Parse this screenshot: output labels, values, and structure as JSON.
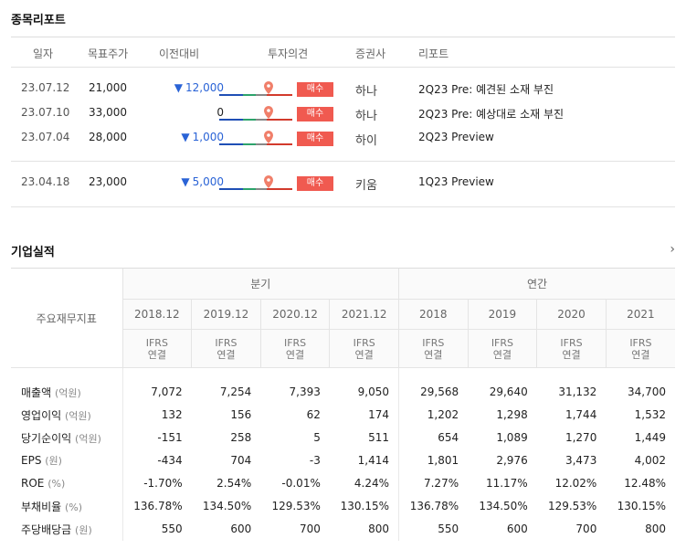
{
  "report_section": {
    "title": "종목리포트",
    "headers": {
      "date": "일자",
      "target": "목표주가",
      "diff": "이전대비",
      "opinion": "투자의견",
      "broker": "증권사",
      "report": "리포트"
    },
    "rows": [
      {
        "date": "23.07.12",
        "target": "21,000",
        "diff": "12,000",
        "dir": "down",
        "opinion": "매수",
        "broker": "하나",
        "report": "2Q23 Pre: 예견된 소재 부진"
      },
      {
        "date": "23.07.10",
        "target": "33,000",
        "diff": "0",
        "dir": "none",
        "opinion": "매수",
        "broker": "하나",
        "report": "2Q23 Pre: 예상대로 소재 부진"
      },
      {
        "date": "23.07.04",
        "target": "28,000",
        "diff": "1,000",
        "dir": "down",
        "opinion": "매수",
        "broker": "하이",
        "report": "2Q23 Preview"
      },
      {
        "date": "23.04.18",
        "target": "23,000",
        "diff": "5,000",
        "dir": "down",
        "opinion": "매수",
        "broker": "키움",
        "report": "1Q23 Preview"
      }
    ],
    "down_arrow": "▼",
    "colors": {
      "down": "#2a63d6",
      "buy_badge": "#f05a50"
    }
  },
  "financials": {
    "title": "기업실적",
    "more_chevron": "›",
    "main_header": "주요재무지표",
    "group_quarter": "분기",
    "group_annual": "연간",
    "periods": [
      "2018.12",
      "2019.12",
      "2020.12",
      "2021.12",
      "2018",
      "2019",
      "2020",
      "2021"
    ],
    "ifrs_line1": "IFRS",
    "ifrs_line2": "연결",
    "rows": [
      {
        "label": "매출액",
        "unit": "(억원)",
        "values": [
          "7,072",
          "7,254",
          "7,393",
          "9,050",
          "29,568",
          "29,640",
          "31,132",
          "34,700"
        ]
      },
      {
        "label": "영업이익",
        "unit": "(억원)",
        "values": [
          "132",
          "156",
          "62",
          "174",
          "1,202",
          "1,298",
          "1,744",
          "1,532"
        ]
      },
      {
        "label": "당기순이익",
        "unit": "(억원)",
        "values": [
          "-151",
          "258",
          "5",
          "511",
          "654",
          "1,089",
          "1,270",
          "1,449"
        ]
      },
      {
        "label": "EPS",
        "unit": "(원)",
        "values": [
          "-434",
          "704",
          "-3",
          "1,414",
          "1,801",
          "2,976",
          "3,473",
          "4,002"
        ]
      },
      {
        "label": "ROE",
        "unit": "(%)",
        "values": [
          "-1.70%",
          "2.54%",
          "-0.01%",
          "4.24%",
          "7.27%",
          "11.17%",
          "12.02%",
          "12.48%"
        ]
      },
      {
        "label": "부채비율",
        "unit": "(%)",
        "values": [
          "136.78%",
          "134.50%",
          "129.53%",
          "130.15%",
          "136.78%",
          "134.50%",
          "129.53%",
          "130.15%"
        ]
      },
      {
        "label": "주당배당금",
        "unit": "(원)",
        "values": [
          "550",
          "600",
          "700",
          "800",
          "550",
          "600",
          "700",
          "800"
        ]
      }
    ]
  }
}
